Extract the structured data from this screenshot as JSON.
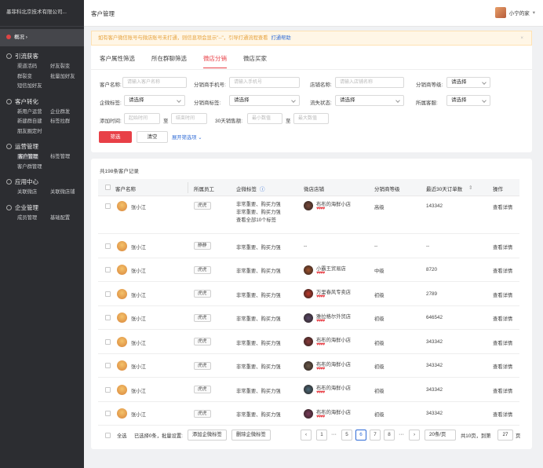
{
  "sidebar": {
    "company": "墨菲科北京技术有限公司...",
    "overview": "概况",
    "groups": [
      {
        "title": "引流获客",
        "items": [
          "渠道活码",
          "好友裂变",
          "群裂变",
          "批量加好友",
          "短信加好友"
        ]
      },
      {
        "title": "客户转化",
        "items": [
          "新用户运营",
          "企业群发",
          "新建群自建",
          "标签拉群",
          "朋友圈定时"
        ]
      },
      {
        "title": "运营管理",
        "items": [
          "客户管理",
          "标签管理",
          "客户群管理"
        ]
      },
      {
        "title": "应用中心",
        "items": [
          "关联微店",
          "关联微店铺"
        ]
      },
      {
        "title": "企业管理",
        "items": [
          "成员管理",
          "基础配置"
        ]
      }
    ]
  },
  "header": {
    "title": "客户管理",
    "user": "小宁的家"
  },
  "notice": {
    "text": "如有客户微信账号与微店账号未打通，则信息项会显示\"--\"，引导打通流程查看",
    "link": "打通帮助",
    "close": "×"
  },
  "tabs": [
    "客户属性筛选",
    "所在群聊筛选",
    "微店分销",
    "微店买家"
  ],
  "filters": {
    "name_label": "客户名称:",
    "name_ph": "请输入客户名称",
    "phone_label": "分销商手机号:",
    "phone_ph": "请输入手机号",
    "shop_label": "店铺名称:",
    "shop_ph": "请输入店铺名称",
    "level_label": "分销商等级:",
    "level_val": "请选择",
    "tag_label": "企微标签:",
    "tag_val": "请选择",
    "dist_tag_label": "分销商标签:",
    "dist_tag_val": "请选择",
    "lost_label": "流失状态:",
    "lost_val": "请选择",
    "cs_label": "所属客服:",
    "cs_val": "请选择",
    "add_time_label": "添加时间:",
    "start_ph": "起始时间",
    "to": "至",
    "end_ph": "结束时间",
    "sales_label": "30天销售额:",
    "min_ph": "最小数值",
    "max_ph": "最大数值",
    "search_btn": "筛选",
    "clear_btn": "清空",
    "expand": "展开筛选项"
  },
  "table": {
    "total": "共198条客户记录",
    "headers": [
      "客户名称",
      "所属员工",
      "企微标签",
      "微店店铺",
      "分销商等级",
      "最近30天订单数",
      "操作"
    ],
    "rows": [
      {
        "name": "张小江",
        "staff": "虎虎",
        "tags": [
          "非常重要、购买力强",
          "非常重要、购买力强"
        ],
        "more": "查看全部10个标签",
        "shop": "布布的海鲜小店",
        "level": "高级",
        "orders": "143342",
        "action": "查看详情"
      },
      {
        "name": "张小江",
        "staff": "静静",
        "tags": [
          "非常重要、购买力强"
        ],
        "shop": "--",
        "level": "--",
        "orders": "--",
        "action": "查看详情"
      },
      {
        "name": "张小江",
        "staff": "虎虎",
        "tags": [
          "非常重要、购买力强"
        ],
        "shop": "小霸王贸易店",
        "level": "中级",
        "orders": "8720",
        "action": "查看详情"
      },
      {
        "name": "张小江",
        "staff": "虎虎",
        "tags": [
          "非常重要、购买力强"
        ],
        "shop": "万里春风专卖店",
        "level": "初级",
        "orders": "2789",
        "action": "查看详情"
      },
      {
        "name": "张小江",
        "staff": "虎虎",
        "tags": [
          "非常重要、购买力强"
        ],
        "shop": "雅拉格尔外贸店",
        "level": "初级",
        "orders": "646542",
        "action": "查看详情"
      },
      {
        "name": "张小江",
        "staff": "虎虎",
        "tags": [
          "非常重要、购买力强"
        ],
        "shop": "布布的海鲜小店",
        "level": "初级",
        "orders": "343342",
        "action": "查看详情"
      },
      {
        "name": "张小江",
        "staff": "虎虎",
        "tags": [
          "非常重要、购买力强"
        ],
        "shop": "布布的海鲜小店",
        "level": "初级",
        "orders": "343342",
        "action": "查看详情"
      },
      {
        "name": "张小江",
        "staff": "虎虎",
        "tags": [
          "非常重要、购买力强"
        ],
        "shop": "布布的海鲜小店",
        "level": "初级",
        "orders": "343342",
        "action": "查看详情"
      },
      {
        "name": "张小江",
        "staff": "虎虎",
        "tags": [
          "非常重要、购买力强"
        ],
        "shop": "布布的海鲜小店",
        "level": "初级",
        "orders": "343342",
        "action": "查看详情"
      }
    ]
  },
  "footer": {
    "select_all": "全选",
    "selected": "已选择0条，批量设置:",
    "add_tag": "添加企微标签",
    "remove_tag": "删除企微标签",
    "pages": [
      "1",
      "5",
      "6",
      "7",
      "8"
    ],
    "ellipsis": "···",
    "current": "6",
    "page_size": "20条/页",
    "total_pages": "共10页，到第",
    "goto": "27",
    "page_unit": "页"
  }
}
